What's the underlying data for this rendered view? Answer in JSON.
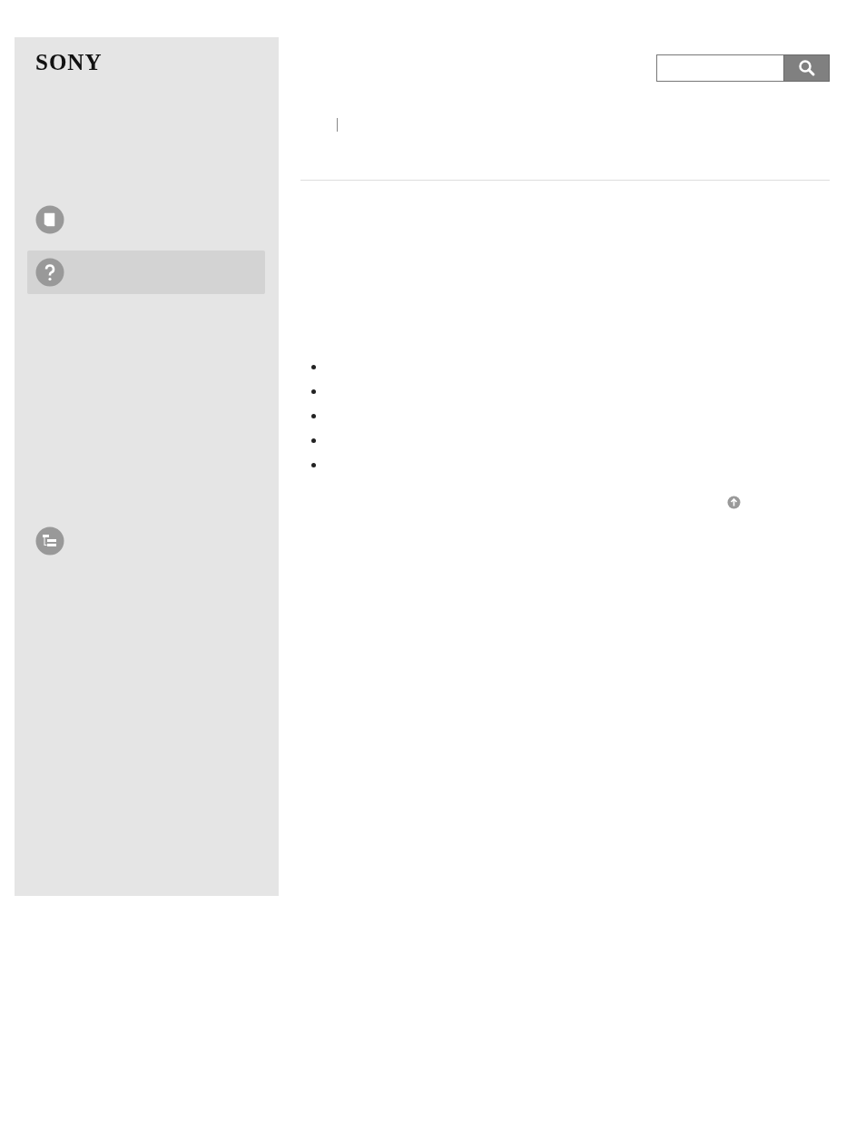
{
  "logo": {
    "text": "SONY"
  },
  "sidebar": {
    "items": [
      {
        "kind": "manual",
        "selected": false
      },
      {
        "kind": "help",
        "selected": true
      },
      {
        "kind": "sitemap",
        "selected": false
      }
    ]
  },
  "search": {
    "kind": "field"
  },
  "bullets": [
    {
      "kind": "bullet"
    },
    {
      "kind": "bullet"
    },
    {
      "kind": "bullet"
    },
    {
      "kind": "bullet"
    },
    {
      "kind": "bullet"
    }
  ]
}
